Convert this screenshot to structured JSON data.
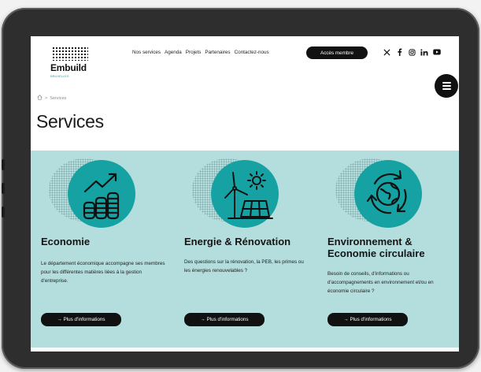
{
  "brand": {
    "name": "Embuild",
    "sub": "BRUXELLES"
  },
  "nav": {
    "items": [
      "Nos services",
      "Agenda",
      "Projets",
      "Partenaires",
      "Contactez-nous"
    ],
    "member_button": "Accès membre"
  },
  "socials": [
    "x-icon",
    "facebook-icon",
    "instagram-icon",
    "linkedin-icon",
    "youtube-icon"
  ],
  "breadcrumb": {
    "home_icon": "home-icon",
    "separator": ">",
    "current": "Services"
  },
  "page": {
    "title": "Services"
  },
  "cards": [
    {
      "icon": "growth-coins-icon",
      "title": "Economie",
      "text": "Le département économique accompagne ses membres pour les différentes matières liées à la gestion d'entreprise.",
      "button": "→ Plus d'informations"
    },
    {
      "icon": "wind-solar-icon",
      "title": "Energie & Rénovation",
      "text": "Des questions sur la rénovation, la PEB, les primes ou les énergies renouvelables ?",
      "button": "→ Plus d'informations"
    },
    {
      "icon": "recycle-globe-icon",
      "title": "Environnement & Economie circulaire",
      "text": "Besoin de conseils, d'informations ou d'accompagnements en environnement et/ou en économie circulaire ?",
      "button": "→ Plus d'informations"
    }
  ],
  "colors": {
    "band": "#b3dedd",
    "icon_circle": "#16a2a2",
    "dark": "#111111"
  }
}
